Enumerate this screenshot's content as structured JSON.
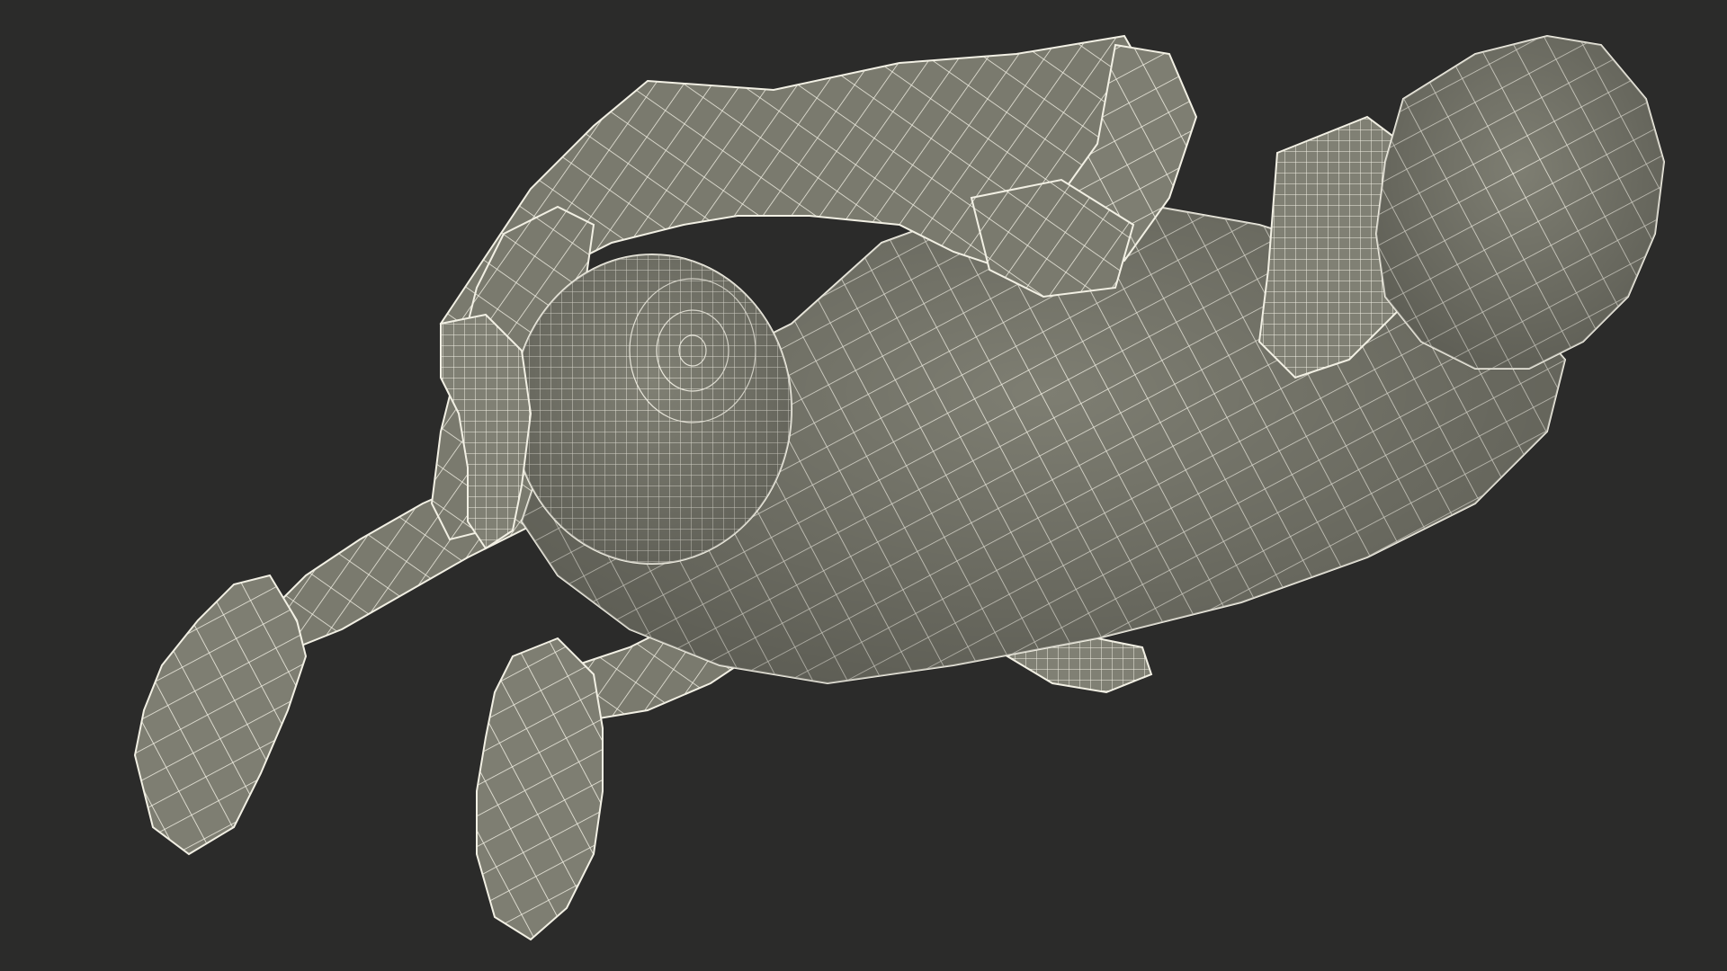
{
  "scene": {
    "background_color": "#2b2b2a",
    "model_fill_color": "#7e7e72",
    "model_shade_color": "#6b6b60",
    "wireframe_color": "#f2f0e4"
  }
}
